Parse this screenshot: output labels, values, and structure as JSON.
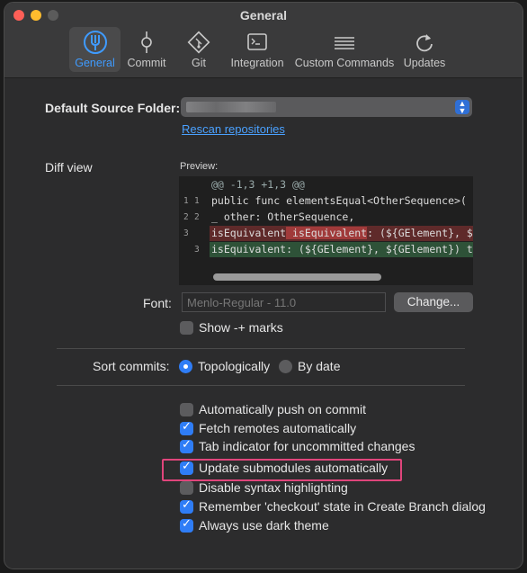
{
  "window": {
    "title": "General"
  },
  "toolbar": {
    "tabs": [
      {
        "label": "General",
        "icon": "general-icon",
        "active": true
      },
      {
        "label": "Commit",
        "icon": "commit-icon"
      },
      {
        "label": "Git",
        "icon": "git-icon"
      },
      {
        "label": "Integration",
        "icon": "terminal-icon"
      },
      {
        "label": "Custom Commands",
        "icon": "list-icon"
      },
      {
        "label": "Updates",
        "icon": "refresh-icon"
      }
    ]
  },
  "source_folder": {
    "label": "Default Source Folder:",
    "rescan_label": "Rescan repositories"
  },
  "diff_view": {
    "label": "Diff view",
    "preview_label": "Preview:",
    "lines": [
      {
        "a": "",
        "b": "",
        "text": "@@ -1,3 +1,3 @@"
      },
      {
        "a": "1",
        "b": "1",
        "text": "public func elementsEqual<OtherSequence>("
      },
      {
        "a": "2",
        "b": "2",
        "text": "_ other: OtherSequence,"
      },
      {
        "a": "3",
        "b": "",
        "pre": "isEquivalent",
        "hl": " isEquivalent",
        "post": ": (${GElement}, $"
      },
      {
        "a": "",
        "b": "3",
        "text": "isEquivalent: (${GElement}, ${GElement}) t"
      }
    ]
  },
  "font": {
    "label": "Font:",
    "value": "Menlo-Regular - 11.0",
    "change_label": "Change..."
  },
  "show_marks": {
    "label": "Show -+ marks",
    "checked": false
  },
  "sort_commits": {
    "label": "Sort commits:",
    "option1": "Topologically",
    "option2": "By date",
    "selected": "Topologically"
  },
  "options": [
    {
      "label": "Automatically push on commit",
      "checked": false
    },
    {
      "label": "Fetch remotes automatically",
      "checked": true
    },
    {
      "label": "Tab indicator for uncommitted changes",
      "checked": true
    },
    {
      "label": "Update submodules automatically",
      "checked": true
    },
    {
      "label": "Disable syntax highlighting",
      "checked": false
    },
    {
      "label": "Remember 'checkout' state in Create Branch dialog",
      "checked": true
    },
    {
      "label": "Always use dark theme",
      "checked": true
    }
  ],
  "colors": {
    "accent": "#2f7df6",
    "link": "#4aa1ff",
    "highlight_box": "#e0457b",
    "deleted_bg": "#5f2a2a",
    "added_bg": "#2e5238"
  }
}
